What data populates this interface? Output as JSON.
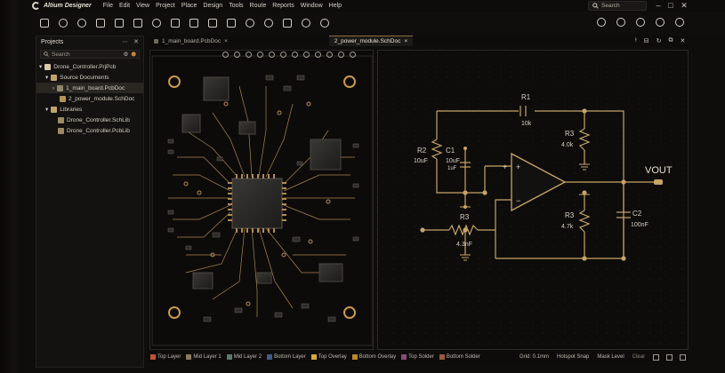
{
  "app": {
    "title": "Altium Designer"
  },
  "menu": [
    "File",
    "Edit",
    "View",
    "Project",
    "Place",
    "Design",
    "Tools",
    "Route",
    "Reports",
    "Window",
    "Help"
  ],
  "search": {
    "placeholder": "Search"
  },
  "projects_panel": {
    "title": "Projects",
    "search_placeholder": "Search",
    "tree": [
      {
        "label": "Drone_Controller.PrjPcb",
        "level": 0,
        "icon": "project-icon"
      },
      {
        "label": "Source Documents",
        "level": 1,
        "icon": "folder-icon"
      },
      {
        "label": "1_main_board.PcbDoc",
        "level": 2,
        "icon": "pcb-doc-icon",
        "selected": true
      },
      {
        "label": "2_power_module.SchDoc",
        "level": 2,
        "icon": "sch-doc-icon"
      },
      {
        "label": "Libraries",
        "level": 1,
        "icon": "folder-icon"
      },
      {
        "label": "Drone_Controller.SchLib",
        "level": 2,
        "icon": "lib-icon"
      },
      {
        "label": "Drone_Controller.PcbLib",
        "level": 2,
        "icon": "lib-icon"
      }
    ]
  },
  "tabs": [
    {
      "label": "1_main_board.PcbDoc",
      "active": false
    },
    {
      "label": "2_power_module.SchDoc",
      "active": true
    }
  ],
  "schematic": {
    "labels": {
      "r1_name": "R1",
      "r1_value": "10k",
      "r2_name": "R2",
      "c1_name": "C1",
      "c1_value": "10uF",
      "r2_value": "10uF",
      "c1_extra": "1uF",
      "r3a_name": "R3",
      "r3a_value": "4.0k",
      "r3b_name": "R3",
      "r3b_value": "4.7k",
      "c2_name": "C2",
      "c2_value": "100nF",
      "r_bot_name": "R3",
      "r_bot_value": "4.3nF",
      "vout": "VOUT",
      "plus": "+",
      "minus": "−"
    }
  },
  "status": {
    "layers": [
      {
        "name": "Top Layer",
        "color": "#c0542f"
      },
      {
        "name": "Mid Layer 1",
        "color": "#8a7a5a"
      },
      {
        "name": "Mid Layer 2",
        "color": "#5c7a6a"
      },
      {
        "name": "Bottom Layer",
        "color": "#3f5d8a"
      },
      {
        "name": "Top Overlay",
        "color": "#d4a93a"
      },
      {
        "name": "Bottom Overlay",
        "color": "#b8882e"
      },
      {
        "name": "Top Solder",
        "color": "#8a4a7a"
      },
      {
        "name": "Bottom Solder",
        "color": "#9a5a3a"
      }
    ],
    "grid": "Grid: 0.1mm",
    "hotspot": "Hotspot Snap",
    "mask": "Mask Level",
    "clear": "Clear"
  },
  "colors": {
    "accent": "#c9a464",
    "trace": "#d6a25a",
    "wire": "#c7a46a"
  }
}
